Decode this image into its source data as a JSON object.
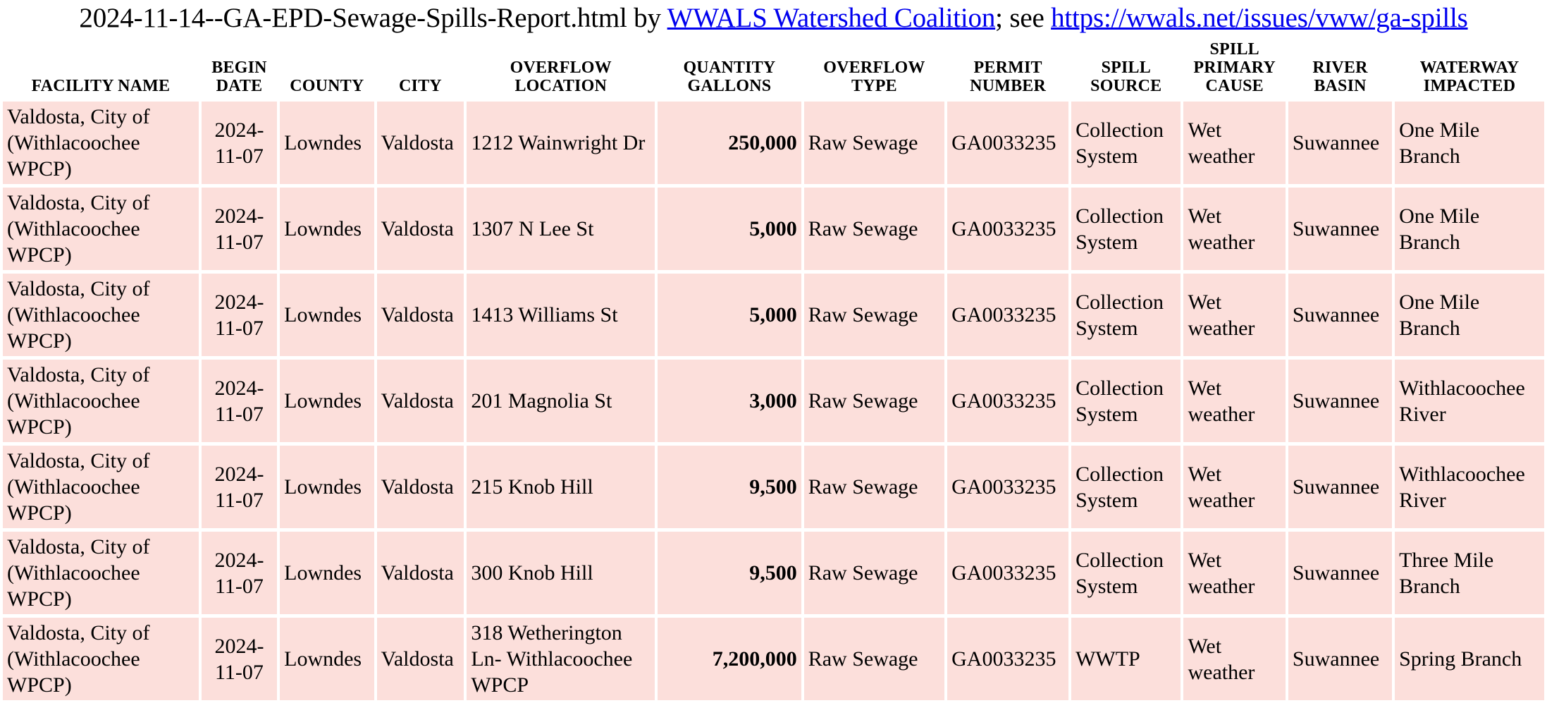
{
  "title": {
    "prefix": "2024-11-14--GA-EPD-Sewage-Spills-Report.html by ",
    "org_link": "WWALS Watershed Coalition",
    "middle": "; see ",
    "url_link": "https://wwals.net/issues/vww/ga-spills"
  },
  "colors": {
    "cell_background": "#fcdfdb",
    "page_background": "#ffffff",
    "link": "#0000ee",
    "text": "#000000"
  },
  "table": {
    "headers": [
      "FACILITY NAME",
      "BEGIN DATE",
      "COUNTY",
      "CITY",
      "OVERFLOW LOCATION",
      "QUANTITY GALLONS",
      "OVERFLOW TYPE",
      "PERMIT NUMBER",
      "SPILL SOURCE",
      "SPILL PRIMARY CAUSE",
      "RIVER BASIN",
      "WATERWAY IMPACTED"
    ],
    "rows": [
      {
        "facility": "Valdosta, City of (Withlacoochee WPCP)",
        "begin_date": "2024-11-07",
        "county": "Lowndes",
        "city": "Valdosta",
        "location": "1212 Wainwright Dr",
        "quantity": "250,000",
        "overflow_type": "Raw Sewage",
        "permit": "GA0033235",
        "source": "Collection System",
        "cause": "Wet weather",
        "basin": "Suwannee",
        "waterway": "One Mile Branch"
      },
      {
        "facility": "Valdosta, City of (Withlacoochee WPCP)",
        "begin_date": "2024-11-07",
        "county": "Lowndes",
        "city": "Valdosta",
        "location": "1307 N Lee St",
        "quantity": "5,000",
        "overflow_type": "Raw Sewage",
        "permit": "GA0033235",
        "source": "Collection System",
        "cause": "Wet weather",
        "basin": "Suwannee",
        "waterway": "One Mile Branch"
      },
      {
        "facility": "Valdosta, City of (Withlacoochee WPCP)",
        "begin_date": "2024-11-07",
        "county": "Lowndes",
        "city": "Valdosta",
        "location": "1413 Williams St",
        "quantity": "5,000",
        "overflow_type": "Raw Sewage",
        "permit": "GA0033235",
        "source": "Collection System",
        "cause": "Wet weather",
        "basin": "Suwannee",
        "waterway": "One Mile Branch"
      },
      {
        "facility": "Valdosta, City of (Withlacoochee WPCP)",
        "begin_date": "2024-11-07",
        "county": "Lowndes",
        "city": "Valdosta",
        "location": "201 Magnolia St",
        "quantity": "3,000",
        "overflow_type": "Raw Sewage",
        "permit": "GA0033235",
        "source": "Collection System",
        "cause": "Wet weather",
        "basin": "Suwannee",
        "waterway": "Withlacoochee River"
      },
      {
        "facility": "Valdosta, City of (Withlacoochee WPCP)",
        "begin_date": "2024-11-07",
        "county": "Lowndes",
        "city": "Valdosta",
        "location": "215 Knob Hill",
        "quantity": "9,500",
        "overflow_type": "Raw Sewage",
        "permit": "GA0033235",
        "source": "Collection System",
        "cause": "Wet weather",
        "basin": "Suwannee",
        "waterway": "Withlacoochee River"
      },
      {
        "facility": "Valdosta, City of (Withlacoochee WPCP)",
        "begin_date": "2024-11-07",
        "county": "Lowndes",
        "city": "Valdosta",
        "location": "300 Knob Hill",
        "quantity": "9,500",
        "overflow_type": "Raw Sewage",
        "permit": "GA0033235",
        "source": "Collection System",
        "cause": "Wet weather",
        "basin": "Suwannee",
        "waterway": "Three Mile Branch"
      },
      {
        "facility": "Valdosta, City of (Withlacoochee WPCP)",
        "begin_date": "2024-11-07",
        "county": "Lowndes",
        "city": "Valdosta",
        "location": "318 Wetherington Ln- Withlacoochee WPCP",
        "quantity": "7,200,000",
        "overflow_type": "Raw Sewage",
        "permit": "GA0033235",
        "source": "WWTP",
        "cause": "Wet weather",
        "basin": "Suwannee",
        "waterway": "Spring Branch"
      }
    ]
  }
}
